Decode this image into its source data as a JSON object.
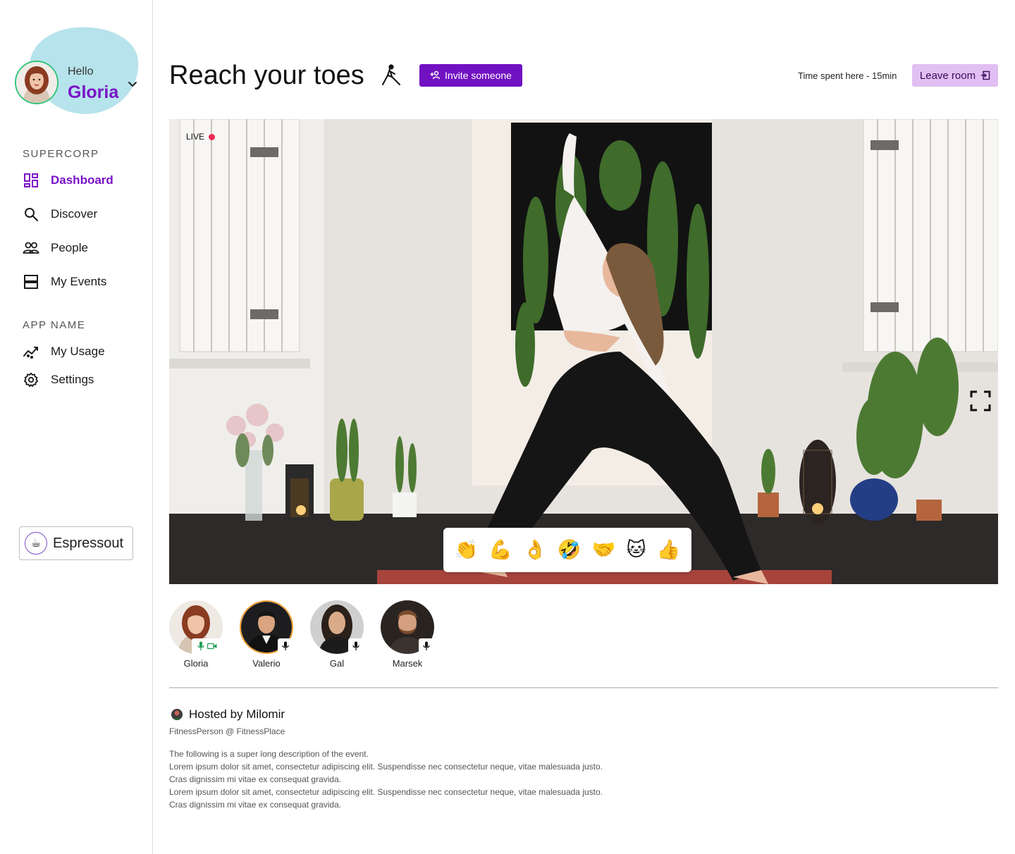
{
  "user": {
    "greeting": "Hello",
    "name": "Gloria"
  },
  "sidebar": {
    "sections": [
      {
        "label": "SUPERCORP",
        "items": [
          {
            "label": "Dashboard",
            "icon": "dashboard-icon",
            "active": true
          },
          {
            "label": "Discover",
            "icon": "search-icon"
          },
          {
            "label": "People",
            "icon": "people-icon"
          },
          {
            "label": "My Events",
            "icon": "events-icon"
          }
        ]
      },
      {
        "label": "APP NAME",
        "items": [
          {
            "label": "My Usage",
            "icon": "usage-icon"
          },
          {
            "label": "Settings",
            "icon": "gear-icon"
          }
        ]
      }
    ],
    "workspace": {
      "name": "Espressout",
      "logo": "☕"
    }
  },
  "header": {
    "title": "Reach your toes",
    "title_icon": "yoga-pose-icon",
    "invite_label": "Invite someone",
    "time_spent": "Time spent here - 15min",
    "leave_label": "Leave room"
  },
  "video": {
    "live_label": "LIVE",
    "reactions": [
      "👏",
      "💪",
      "👌",
      "🤣",
      "🤝",
      "🐱",
      "👍"
    ]
  },
  "participants": [
    {
      "name": "Gloria",
      "mic": true,
      "camera": true,
      "speaking": false
    },
    {
      "name": "Valerio",
      "mic": true,
      "camera": false,
      "speaking": true
    },
    {
      "name": "Gal",
      "mic": true,
      "camera": false,
      "speaking": false
    },
    {
      "name": "Marsek",
      "mic": true,
      "camera": false,
      "speaking": false
    }
  ],
  "host": {
    "label": "Hosted by Milomir",
    "role": "FitnessPerson @ FitnessPlace",
    "description": [
      "The following is a super long description of the event.",
      "Lorem ipsum dolor sit amet, consectetur adipiscing elit. Suspendisse nec consectetur neque, vitae malesuada justo.",
      "Cras dignissim mi vitae ex consequat gravida.",
      "Lorem ipsum dolor sit amet, consectetur adipiscing elit. Suspendisse nec consectetur neque, vitae malesuada justo.",
      "Cras dignissim mi vitae ex consequat gravida."
    ]
  },
  "colors": {
    "accent": "#7211c2",
    "accent_text": "#7a12c7",
    "leave_bg": "#e1bff2",
    "blob": "#b7e3ec",
    "live_dot": "#ee2a55",
    "speaking_ring": "#f3a237",
    "status_green": "#1f9d55"
  }
}
